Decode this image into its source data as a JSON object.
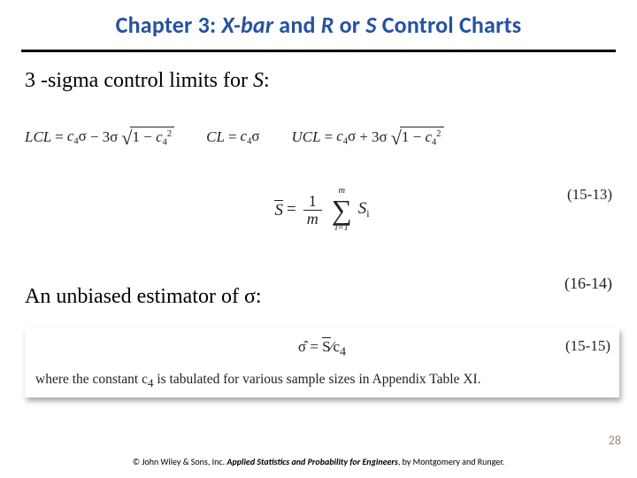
{
  "title": {
    "prefix": "Chapter 3: ",
    "part1_ital": "X-bar",
    "mid": " and ",
    "part2_ital": "R",
    "mid2": " or ",
    "part3_ital": "S",
    "suffix": " Control Charts"
  },
  "lead1": {
    "text": "3 -sigma control limits for ",
    "var": "S",
    "colon": ":"
  },
  "eq_15_13": {
    "lcl_label": "LCL",
    "cl_label": "CL",
    "ucl_label": "UCL",
    "eq": "=",
    "c4": "c",
    "c4_sub": "4",
    "sigma": "σ",
    "minus": " − 3σ",
    "plus": " + 3σ",
    "sqrt_body_pre": "1 − ",
    "sqrt_c": "c",
    "sqrt_sub": "4",
    "sqrt_sup": "2",
    "number": "(15-13)"
  },
  "eq_16_14": {
    "lhs_var": "S",
    "eq": " = ",
    "frac_num": "1",
    "frac_den": "m",
    "sum_upper": "m",
    "sum_lower": "i=1",
    "si_var": "S",
    "si_sub": "i",
    "number": "(16-14)"
  },
  "lead2": {
    "text": "An unbiased estimator of σ:"
  },
  "eq_15_15": {
    "lhs": "σ̂",
    "eq": " = ",
    "rhs_s": "S",
    "slash": "∕",
    "c4": "c",
    "c4_sub": "4",
    "number": "(15-15)",
    "note_pre": "where the constant ",
    "note_c": "c",
    "note_sub": "4",
    "note_post": " is tabulated for various sample sizes in Appendix Table XI."
  },
  "page_number": "28",
  "footer": {
    "pre": "© John Wiley & Sons, Inc.  ",
    "book": "Applied Statistics and Probability for Engineers",
    "post": ", by Montgomery and Runger."
  }
}
